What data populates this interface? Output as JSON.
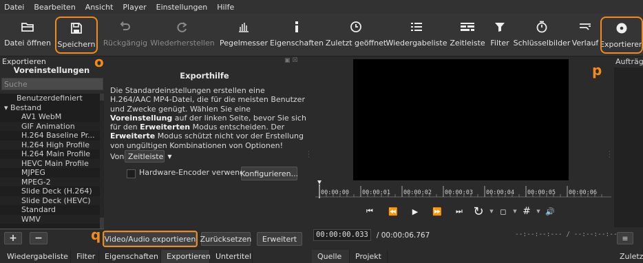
{
  "menu": [
    "Datei",
    "Bearbeiten",
    "Ansicht",
    "Player",
    "Einstellungen",
    "Hilfe"
  ],
  "toolbar": {
    "open": "Datei öffnen",
    "save": "Speichern",
    "undo": "Rückgängig",
    "redo": "Wiederherstellen",
    "peak": "Pegelmesser",
    "props": "Eigenschaften",
    "recent": "Zuletzt geöffnet",
    "playlist": "Wiedergabeliste",
    "timeline": "Zeitleiste",
    "filter": "Filter",
    "keyframes": "Schlüsselbilder",
    "history": "Verlauf",
    "export": "Exportieren"
  },
  "annotations": {
    "o": "o",
    "p": "p",
    "q": "q"
  },
  "export": {
    "panel_title": "Exportieren",
    "presets_heading": "Voreinstellungen",
    "search_placeholder": "Suche",
    "presets": [
      {
        "label": "Benutzerdefiniert",
        "indent": 1
      },
      {
        "label": "▾  Bestand",
        "indent": 0
      },
      {
        "label": "AV1 WebM",
        "indent": 2
      },
      {
        "label": "GIF Animation",
        "indent": 2
      },
      {
        "label": "H.264 Baseline Pr...",
        "indent": 2
      },
      {
        "label": "H.264 High Profile",
        "indent": 2
      },
      {
        "label": "H.264 Main Profile",
        "indent": 2
      },
      {
        "label": "HEVC Main Profile",
        "indent": 2
      },
      {
        "label": "MJPEG",
        "indent": 2
      },
      {
        "label": "MPEG-2",
        "indent": 2
      },
      {
        "label": "Slide Deck (H.264)",
        "indent": 2
      },
      {
        "label": "Slide Deck (HEVC)",
        "indent": 2
      },
      {
        "label": "Standard",
        "indent": 2
      },
      {
        "label": "WMV",
        "indent": 2
      }
    ],
    "help_title": "Exporthilfe",
    "help_p1": "Die Standardeinstellungen erstellen eine H.264/AAC MP4-Datei, die für die meisten Benutzer und Zwecke genügt. Wählen Sie eine ",
    "help_b1": "Voreinstellung",
    "help_p2": " auf der linken Seite, bevor Sie sich für den ",
    "help_b2": "Erweiterten",
    "help_p3": " Modus entscheiden. Der ",
    "help_b3": "Erweiterte",
    "help_p4": " Modus schützt nicht vor der Erstellung von ungültigen Kombinationen von Optionen!",
    "from_label": "Von",
    "from_value": "Zeitleiste",
    "hw_label": "Hardware-Encoder verwenden",
    "configure": "Konfigurieren...",
    "export_av": "Video/Audio exportieren",
    "reset": "Zurücksetzen",
    "advanced": "Erweitert"
  },
  "bottom_tabs_left": [
    "Wiedergabeliste",
    "Filter",
    "Eigenschaften",
    "Exportieren",
    "Untertitel"
  ],
  "bottom_tabs_player": [
    "Quelle",
    "Projekt"
  ],
  "player": {
    "timecode": "00:00:00.033",
    "duration": "/  00:00:06.767",
    "inout": "--:--:--:---  /  --:--:--:---",
    "ticks": [
      "00:00:00",
      "00:00:01",
      "00:00:02",
      "00:00:03",
      "00:00:04",
      "00:00:05",
      "00:00:06"
    ]
  },
  "jobs": {
    "title": "Aufträge",
    "tab": "Zuletzt"
  }
}
